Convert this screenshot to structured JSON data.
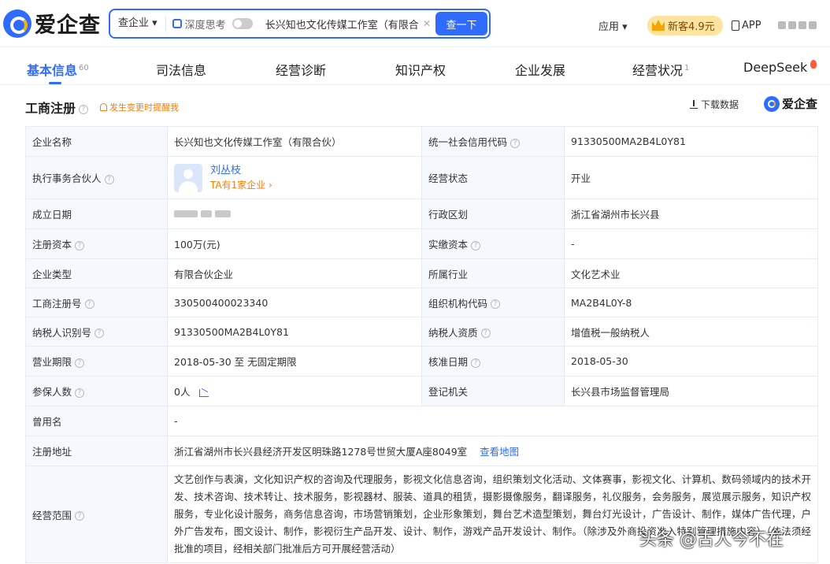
{
  "header": {
    "logo_text": "爱企查",
    "search_type": "查企业 ▾",
    "deep_think_label": "深度思考",
    "search_value": "长兴知也文化传媒工作室（有限合伙",
    "search_button": "查一下",
    "apply_label": "应用 ▾",
    "promo_label": "新客4.9元",
    "app_label": "APP"
  },
  "tabs": [
    {
      "label": "基本信息",
      "count": "60"
    },
    {
      "label": "司法信息",
      "count": ""
    },
    {
      "label": "经营诊断",
      "count": ""
    },
    {
      "label": "知识产权",
      "count": ""
    },
    {
      "label": "企业发展",
      "count": ""
    },
    {
      "label": "经营状况",
      "count": "1"
    },
    {
      "label": "DeepSeek",
      "count": ""
    }
  ],
  "section": {
    "title": "工商注册",
    "remind_label": "发生变更时提醒我",
    "download_label": "下载数据",
    "brand_label": "爱企查"
  },
  "table": {
    "r1": {
      "l1": "企业名称",
      "v1": "长兴知也文化传媒工作室（有限合伙）",
      "l2": "统一社会信用代码",
      "v2": "91330500MA2B4L0Y81"
    },
    "r2": {
      "l1": "执行事务合伙人",
      "person_name": "刘丛枝",
      "person_count": "TA有1家企业 ›",
      "l2": "经营状态",
      "v2": "开业"
    },
    "r3": {
      "l1": "成立日期",
      "l2": "行政区划",
      "v2": "浙江省湖州市长兴县"
    },
    "r4": {
      "l1": "注册资本",
      "v1": "100万(元)",
      "l2": "实缴资本",
      "v2": "-"
    },
    "r5": {
      "l1": "企业类型",
      "v1": "有限合伙企业",
      "l2": "所属行业",
      "v2": "文化艺术业"
    },
    "r6": {
      "l1": "工商注册号",
      "v1": "330500400023340",
      "l2": "组织机构代码",
      "v2": "MA2B4L0Y-8"
    },
    "r7": {
      "l1": "纳税人识别号",
      "v1": "91330500MA2B4L0Y81",
      "l2": "纳税人资质",
      "v2": "增值税一般纳税人"
    },
    "r8": {
      "l1": "营业期限",
      "v1": "2018-05-30 至 无固定期限",
      "l2": "核准日期",
      "v2": "2018-05-30"
    },
    "r9": {
      "l1": "参保人数",
      "v1": "0人",
      "l2": "登记机关",
      "v2": "长兴县市场监督管理局"
    },
    "r10": {
      "l1": "曾用名",
      "v1": "-"
    },
    "r11": {
      "l1": "注册地址",
      "v1": "浙江省湖州市长兴县经济开发区明珠路1278号世贸大厦A座8049室",
      "map_link": "查看地图"
    },
    "r12": {
      "l1": "经营范围",
      "v1": "文艺创作与表演，文化知识产权的咨询及代理服务，影视文化信息咨询，组织策划文化活动、文体赛事，影视文化、计算机、数码领域内的技术开发、技术咨询、技术转让、技术服务，影视器材、服装、道具的租赁，摄影摄像服务，翻译服务，礼仪服务，会务服务，展览展示服务，知识产权服务，专业化设计服务，商务信息咨询，市场营销策划，企业形象策划，舞台艺术造型策划，舞台灯光设计，广告设计、制作，媒体广告代理，户外广告发布，图文设计、制作，影视衍生产品开发、设计、制作，游戏产品开发设计、制作。（除涉及外商投资准入特别管理措施内容）（依法须经批准的项目，经相关部门批准后方可开展经营活动）"
    }
  },
  "watermark": "头条 @古人今不在"
}
